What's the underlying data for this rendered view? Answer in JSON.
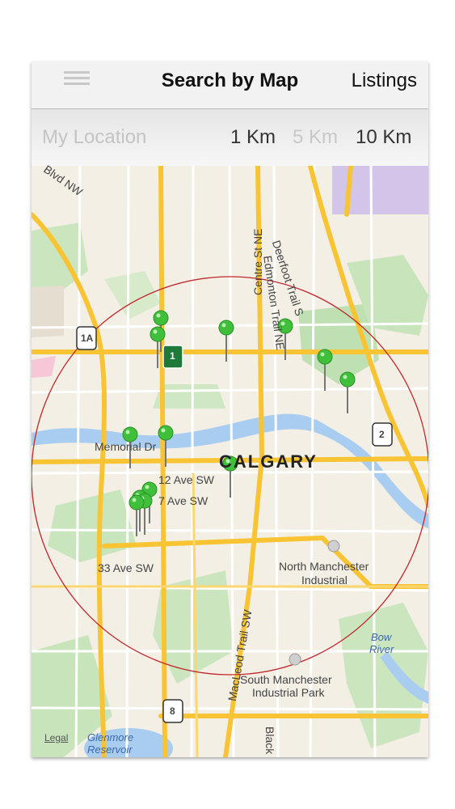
{
  "navbar": {
    "title": "Search by Map",
    "listings_label": "Listings",
    "menu_icon": "hamburger-menu-icon"
  },
  "filter": {
    "my_location": "My Location",
    "distances": [
      {
        "label": "1 Km",
        "state": "enabled"
      },
      {
        "label": "5 Km",
        "state": "disabled"
      },
      {
        "label": "10 Km",
        "state": "selected"
      }
    ]
  },
  "map": {
    "city": "CALGARY",
    "labels": {
      "blvd": "Blvd NW",
      "deerfoot": "Deerfoot Trail S",
      "centre_st": "Centre St NE",
      "edmonton": "Edmonton Trail NE",
      "memorial": "Memorial Dr",
      "ave12": "12 Ave SW",
      "ave17": "7 Ave SW",
      "ave33": "33 Ave SW",
      "north_manchester": "North Manchester",
      "industrial": "Industrial",
      "macleod": "MacLeod Trail SW",
      "south_manchester": "South Manchester",
      "industrial_park": "Industrial Park",
      "black": "Black",
      "bow_river": "Bow",
      "bow_river2": "River",
      "glenmore": "Glenmore",
      "reservoir": "Reservoir",
      "legal": "Legal"
    },
    "shields": [
      "1A",
      "1",
      "2",
      "8"
    ],
    "shield_province": "Alberta",
    "pin_color": "#3fbf3a",
    "radius_color": "#c0262b"
  }
}
